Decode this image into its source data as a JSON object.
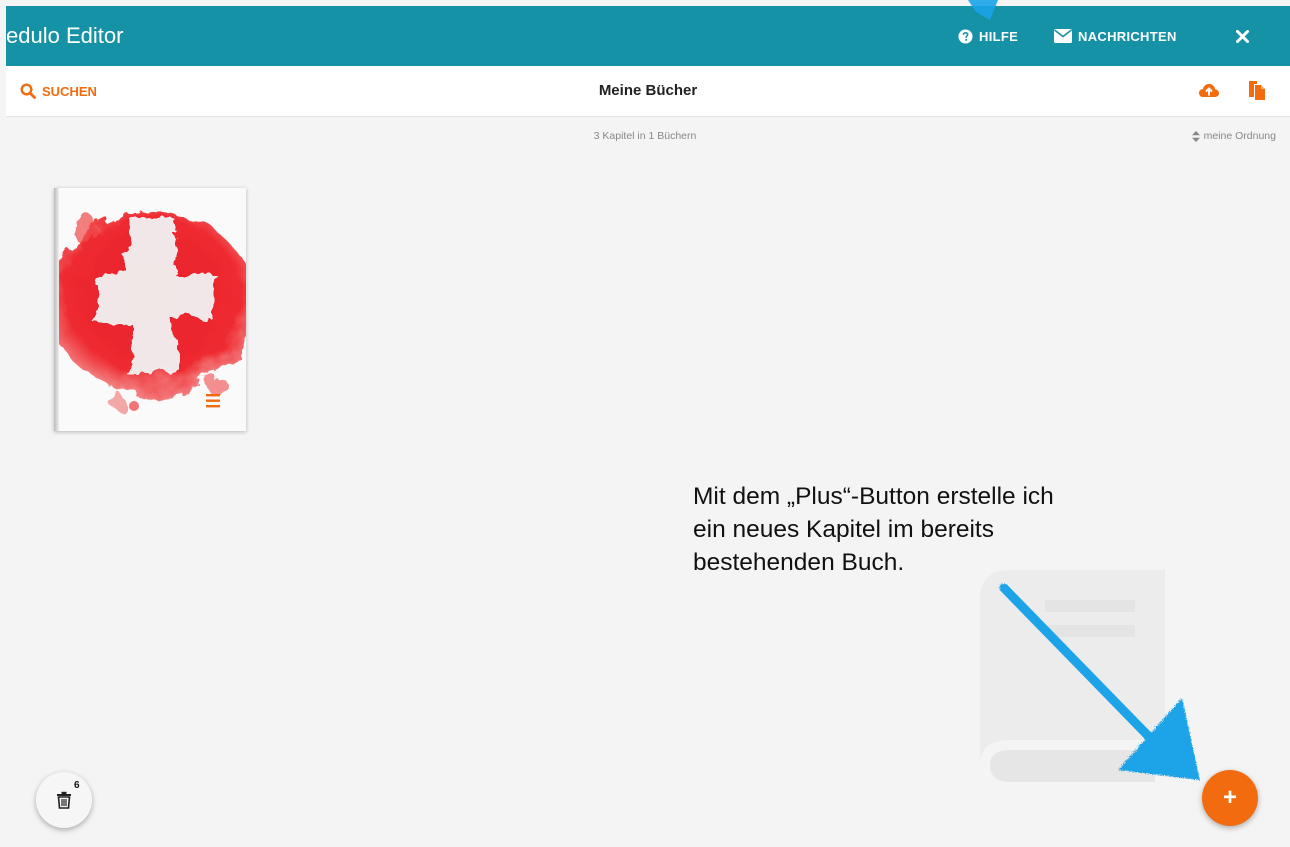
{
  "app": {
    "title": "edulo Editor"
  },
  "header": {
    "help_label": "HILFE",
    "messages_label": "NACHRICHTEN"
  },
  "toolbar": {
    "search_label": "SUCHEN",
    "page_title": "Meine Bücher"
  },
  "library": {
    "count_text": "3 Kapitel in 1 Büchern",
    "sort_label": "meine Ordnung"
  },
  "annotation": {
    "lines": [
      "Mit dem „Plus“-Button erstelle ich",
      "ein neues Kapitel im bereits",
      "bestehenden Buch."
    ]
  },
  "trash": {
    "count": "6"
  },
  "add_button": {
    "label": "+"
  },
  "colors": {
    "header_bg": "#1592a6",
    "accent": "#f26b0f",
    "annotation_arrow": "#1aa3e8",
    "flag_red": "#e8202a"
  },
  "icons": [
    "question-circle-icon",
    "envelope-icon",
    "close-icon",
    "search-icon",
    "cloud-upload-icon",
    "copy-document-icon",
    "sort-icon",
    "menu-icon",
    "trash-icon",
    "plus-icon"
  ]
}
